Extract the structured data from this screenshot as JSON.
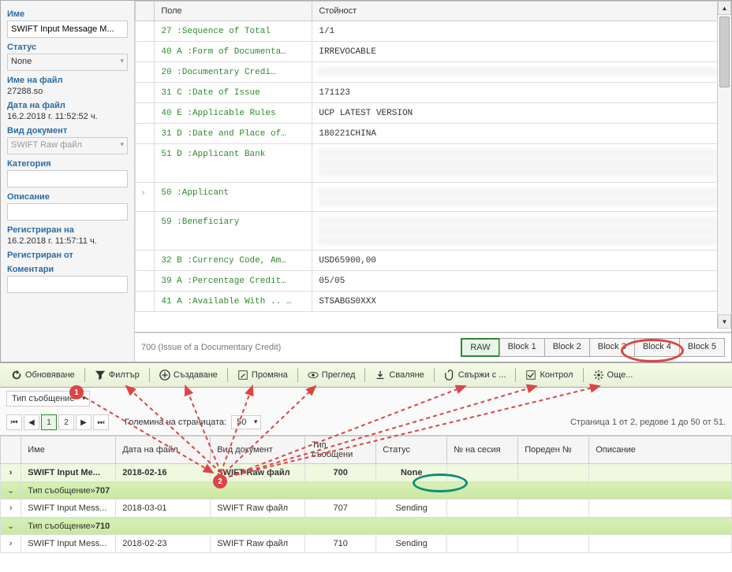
{
  "sidebar": {
    "name_label": "Име",
    "name_value": "SWIFT Input Message M...",
    "status_label": "Статус",
    "status_value": "None",
    "filename_label": "Име на файл",
    "filename_value": "27288.so",
    "filedate_label": "Дата на файл",
    "filedate_value": "16.2.2018 г. 11:52:52 ч.",
    "doctype_label": "Вид документ",
    "doctype_value": "SWIFT Raw файл",
    "category_label": "Категория",
    "category_value": "",
    "description_label": "Описание",
    "description_value": "",
    "registered_label": "Регистриран на",
    "registered_value": "16.2.2018 г. 11:57:11 ч.",
    "registeredby_label": "Регистриран от",
    "registeredby_value": "",
    "comments_label": "Коментари",
    "comments_value": ""
  },
  "swift_header": {
    "col_field": "Поле",
    "col_value": "Стойност"
  },
  "swift_rows": [
    {
      "tag": "27  :Sequence of Total",
      "val": "1/1"
    },
    {
      "tag": "40 A :Form of Documenta…",
      "val": "IRREVOCABLE"
    },
    {
      "tag": "20  :Documentary Credi…",
      "val": "",
      "redact": true
    },
    {
      "tag": "31 C :Date of Issue",
      "val": "171123"
    },
    {
      "tag": "40 E :Applicable Rules",
      "val": "UCP LATEST VERSION"
    },
    {
      "tag": "31 D :Date and Place of…",
      "val": "180221CHINA"
    },
    {
      "tag": "51 D :Applicant Bank",
      "val": "",
      "redact": true,
      "multi": 3
    },
    {
      "tag": "50  :Applicant",
      "val": "",
      "redact": true,
      "multi": 2,
      "expand": true
    },
    {
      "tag": "59  :Beneficiary",
      "val": "",
      "redact": true,
      "multi": 3
    },
    {
      "tag": "32 B :Currency Code, Am…",
      "val": "USD65900,00"
    },
    {
      "tag": "39 A :Percentage Credit…",
      "val": "05/05"
    },
    {
      "tag": "41 A :Available With .. …",
      "val": "STSABGS0XXX"
    }
  ],
  "bottom": {
    "title": "700 (Issue of a Documentary Credit)"
  },
  "tabs": {
    "raw": "RAW",
    "b1": "Block 1",
    "b2": "Block 2",
    "b3": "Block 3",
    "b4": "Block 4",
    "b5": "Block 5"
  },
  "toolbar": {
    "refresh": "Обновяване",
    "filter": "Филтър",
    "create": "Създаване",
    "edit": "Промяна",
    "view": "Преглед",
    "download": "Сваляне",
    "link": "Свържи с ...",
    "control": "Контрол",
    "more": "Още..."
  },
  "filter": {
    "msgtype_label": "Тип съобщение"
  },
  "pagination": {
    "page_size_label": "Големина на страницата:",
    "page_size": "50",
    "page1": "1",
    "page2": "2",
    "info": "Страница 1 от 2, редове 1 до 50 от 51."
  },
  "grid": {
    "cols": {
      "name": "Име",
      "filedate": "Дата на файл",
      "doctype": "Вид документ",
      "msgtype": "Тип съобщени",
      "status": "Статус",
      "session": "№ на сесия",
      "seq": "Пореден №",
      "desc": "Описание"
    },
    "sel": {
      "name": "SWIFT Input Me...",
      "date": "2018-02-16",
      "doctype": "SWIFT Raw файл",
      "msgtype": "700",
      "status": "None"
    },
    "g707": {
      "label": "Тип съобщение»",
      "val": "707"
    },
    "r707": {
      "name": "SWIFT Input Mess...",
      "date": "2018-03-01",
      "doctype": "SWIFT Raw файл",
      "msgtype": "707",
      "status": "Sending"
    },
    "g710": {
      "label": "Тип съобщение»",
      "val": "710"
    },
    "r710": {
      "name": "SWIFT Input Mess...",
      "date": "2018-02-23",
      "doctype": "SWIFT Raw файл",
      "msgtype": "710",
      "status": "Sending"
    }
  }
}
